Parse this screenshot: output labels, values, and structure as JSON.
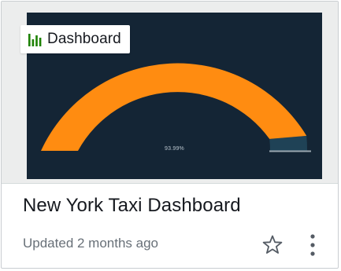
{
  "card": {
    "type_label": "Dashboard",
    "type_icon": "bar-chart-icon",
    "title": "New York Taxi Dashboard",
    "updated": "Updated 2 months ago",
    "favorite_icon": "star-outline-icon",
    "more_icon": "vertical-ellipsis-icon"
  },
  "thumbnail": {
    "gauge_value_label": "93.99%",
    "gauge_value_percent": 93.99,
    "colors": {
      "background": "#142535",
      "filled": "#ff8c11",
      "unfilled": "#1f4256",
      "baseline": "#9aa6b0",
      "badge_icon": "#1d8102"
    }
  }
}
